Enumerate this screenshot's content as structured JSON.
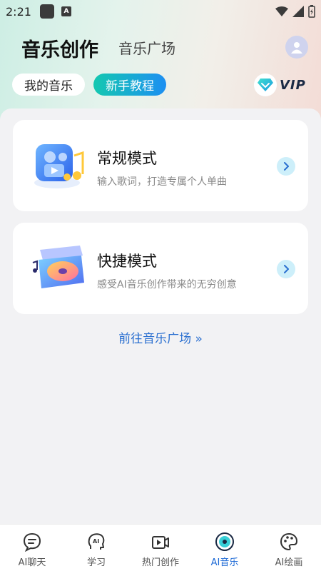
{
  "status_bar": {
    "time": "2:21",
    "a_badge": "A"
  },
  "header": {
    "title": "音乐创作",
    "tab": "音乐广场"
  },
  "pills": {
    "my_music": "我的音乐",
    "tutorial": "新手教程"
  },
  "vip": {
    "label": "VIP"
  },
  "cards": [
    {
      "title": "常规模式",
      "desc": "输入歌词，打造专属个人单曲"
    },
    {
      "title": "快捷模式",
      "desc": "感受AI音乐创作带来的无穷创意"
    }
  ],
  "link": {
    "label": "前往音乐广场 »"
  },
  "nav": [
    {
      "label": "AI聊天",
      "icon": "chat-icon"
    },
    {
      "label": "学习",
      "icon": "ai-head-icon"
    },
    {
      "label": "热门创作",
      "icon": "video-camera-icon"
    },
    {
      "label": "AI音乐",
      "icon": "music-disc-icon"
    },
    {
      "label": "AI绘画",
      "icon": "palette-icon"
    }
  ],
  "colors": {
    "accent": "#1e6ad6",
    "pill_gradient_start": "#14c8b0",
    "pill_gradient_end": "#1c8ff2"
  }
}
